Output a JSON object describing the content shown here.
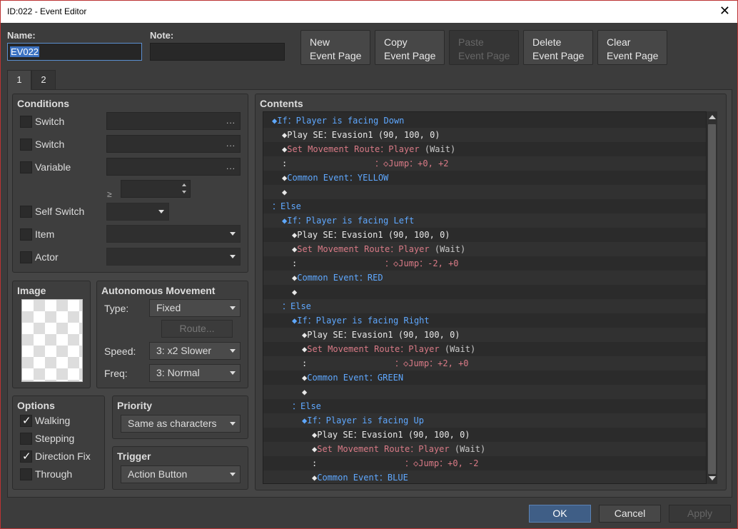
{
  "window": {
    "title": "ID:022 - Event Editor",
    "close_glyph": "✕"
  },
  "name_label": "Name:",
  "name_value": "EV022",
  "note_label": "Note:",
  "note_value": "",
  "toolbar": [
    {
      "label": "New\nEvent Page",
      "enabled": true
    },
    {
      "label": "Copy\nEvent Page",
      "enabled": true
    },
    {
      "label": "Paste\nEvent Page",
      "enabled": false
    },
    {
      "label": "Delete\nEvent Page",
      "enabled": true
    },
    {
      "label": "Clear\nEvent Page",
      "enabled": true
    }
  ],
  "tabs": [
    "1",
    "2"
  ],
  "conditions": {
    "heading": "Conditions",
    "switch1": "Switch",
    "switch2": "Switch",
    "variable": "Variable",
    "ge": "≥",
    "self_switch": "Self Switch",
    "item": "Item",
    "actor": "Actor",
    "dots": "..."
  },
  "image": {
    "heading": "Image"
  },
  "movement": {
    "heading": "Autonomous Movement",
    "type_label": "Type:",
    "type_value": "Fixed",
    "route_button": "Route...",
    "speed_label": "Speed:",
    "speed_value": "3: x2 Slower",
    "freq_label": "Freq:",
    "freq_value": "3: Normal"
  },
  "options": {
    "heading": "Options",
    "walking": "Walking",
    "stepping": "Stepping",
    "direction_fix": "Direction Fix",
    "through": "Through",
    "walking_checked": true,
    "stepping_checked": false,
    "direction_fix_checked": true,
    "through_checked": false
  },
  "priority": {
    "heading": "Priority",
    "value": "Same as characters"
  },
  "trigger": {
    "heading": "Trigger",
    "value": "Action Button"
  },
  "contents": {
    "heading": "Contents",
    "lines": [
      {
        "indent": 0,
        "parts": [
          [
            "◆If：Player is facing Down",
            "blue"
          ]
        ]
      },
      {
        "indent": 1,
        "parts": [
          [
            "◆",
            "white"
          ],
          [
            "Play SE：Evasion1 (90, 100, 0)",
            "white"
          ]
        ]
      },
      {
        "indent": 1,
        "parts": [
          [
            "◆",
            "white"
          ],
          [
            "Set Movement Route：Player ",
            "pink"
          ],
          [
            "(Wait)",
            "gray"
          ]
        ]
      },
      {
        "indent": 1,
        "parts": [
          [
            ":                 ",
            "white"
          ],
          [
            "：◇Jump：+0, +2",
            "pink"
          ]
        ]
      },
      {
        "indent": 1,
        "parts": [
          [
            "◆",
            "white"
          ],
          [
            "Common Event：YELLOW",
            "blue"
          ]
        ]
      },
      {
        "indent": 1,
        "parts": [
          [
            "◆",
            "white"
          ]
        ]
      },
      {
        "indent": 0,
        "parts": [
          [
            "：Else",
            "blue"
          ]
        ]
      },
      {
        "indent": 1,
        "parts": [
          [
            "◆If：Player is facing Left",
            "blue"
          ]
        ]
      },
      {
        "indent": 2,
        "parts": [
          [
            "◆",
            "white"
          ],
          [
            "Play SE：Evasion1 (90, 100, 0)",
            "white"
          ]
        ]
      },
      {
        "indent": 2,
        "parts": [
          [
            "◆",
            "white"
          ],
          [
            "Set Movement Route：Player ",
            "pink"
          ],
          [
            "(Wait)",
            "gray"
          ]
        ]
      },
      {
        "indent": 2,
        "parts": [
          [
            ":                 ",
            "white"
          ],
          [
            "：◇Jump：-2, +0",
            "pink"
          ]
        ]
      },
      {
        "indent": 2,
        "parts": [
          [
            "◆",
            "white"
          ],
          [
            "Common Event：RED",
            "blue"
          ]
        ]
      },
      {
        "indent": 2,
        "parts": [
          [
            "◆",
            "white"
          ]
        ]
      },
      {
        "indent": 1,
        "parts": [
          [
            "：Else",
            "blue"
          ]
        ]
      },
      {
        "indent": 2,
        "parts": [
          [
            "◆If：Player is facing Right",
            "blue"
          ]
        ]
      },
      {
        "indent": 3,
        "parts": [
          [
            "◆",
            "white"
          ],
          [
            "Play SE：Evasion1 (90, 100, 0)",
            "white"
          ]
        ]
      },
      {
        "indent": 3,
        "parts": [
          [
            "◆",
            "white"
          ],
          [
            "Set Movement Route：Player ",
            "pink"
          ],
          [
            "(Wait)",
            "gray"
          ]
        ]
      },
      {
        "indent": 3,
        "parts": [
          [
            ":                 ",
            "white"
          ],
          [
            "：◇Jump：+2, +0",
            "pink"
          ]
        ]
      },
      {
        "indent": 3,
        "parts": [
          [
            "◆",
            "white"
          ],
          [
            "Common Event：GREEN",
            "blue"
          ]
        ]
      },
      {
        "indent": 3,
        "parts": [
          [
            "◆",
            "white"
          ]
        ]
      },
      {
        "indent": 2,
        "parts": [
          [
            "：Else",
            "blue"
          ]
        ]
      },
      {
        "indent": 3,
        "parts": [
          [
            "◆If：Player is facing Up",
            "blue"
          ]
        ]
      },
      {
        "indent": 4,
        "parts": [
          [
            "◆",
            "white"
          ],
          [
            "Play SE：Evasion1 (90, 100, 0)",
            "white"
          ]
        ]
      },
      {
        "indent": 4,
        "parts": [
          [
            "◆",
            "white"
          ],
          [
            "Set Movement Route：Player ",
            "pink"
          ],
          [
            "(Wait)",
            "gray"
          ]
        ]
      },
      {
        "indent": 4,
        "parts": [
          [
            ":                 ",
            "white"
          ],
          [
            "：◇Jump：+0, -2",
            "pink"
          ]
        ]
      },
      {
        "indent": 4,
        "parts": [
          [
            "◆",
            "white"
          ],
          [
            "Common Event：BLUE",
            "blue"
          ]
        ]
      }
    ]
  },
  "footer": {
    "ok": "OK",
    "cancel": "Cancel",
    "apply": "Apply"
  },
  "colors": {
    "blue": "#5fa8ff",
    "pink": "#d97a86",
    "white": "#e8e8e8",
    "gray": "#c8c8c8"
  }
}
